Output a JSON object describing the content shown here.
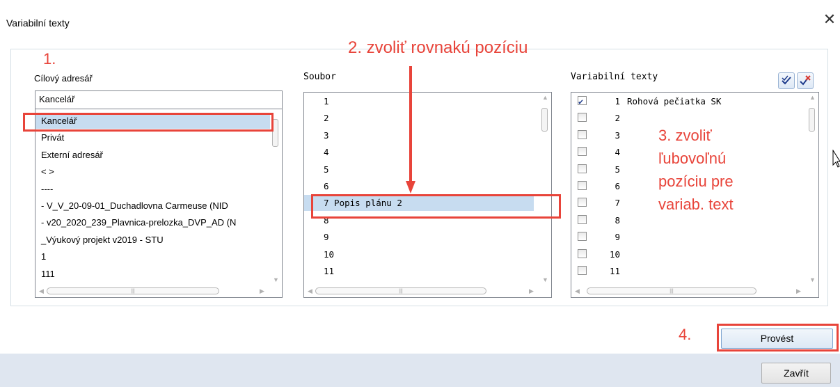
{
  "dialog": {
    "title": "Variabilní texty",
    "close_glyph": "✕"
  },
  "annotations": {
    "a1": "1.",
    "a2": "2. zvoliť rovnakú pozíciu",
    "a3_line1": "3. zvoliť",
    "a3_line2": "ľubovoľnú",
    "a3_line3": "pozíciu pre",
    "a3_line4": "variab. text",
    "a4": "4.",
    "color": "#e8443a"
  },
  "target_dir": {
    "label": "Cílový adresář",
    "combo_value": "Kancelář",
    "items": [
      "Kancelář",
      "Privát",
      "Externí adresář",
      "<       >",
      "----",
      "- V_V_20-09-01_Duchadlovna Carmeuse (NID",
      "- v20_2020_239_Plavnica-prelozka_DVP_AD (N",
      "_Výukový projekt v2019 - STU",
      "1",
      "111"
    ],
    "selected_index": 0
  },
  "file": {
    "label": "Soubor",
    "items": [
      "1",
      "2",
      "3",
      "4",
      "5",
      "6",
      "7 Popis plánu 2",
      "8",
      "9",
      "10",
      "11"
    ],
    "selected_index": 6
  },
  "variable_texts": {
    "label": "Variabilní texty",
    "check_all_icon": "check-all-icon",
    "uncheck_all_icon": "uncheck-all-icon",
    "items": [
      {
        "num": "1",
        "text": "Rohová pečiatka SK",
        "checked": true
      },
      {
        "num": "2",
        "text": "",
        "checked": false
      },
      {
        "num": "3",
        "text": "",
        "checked": false
      },
      {
        "num": "4",
        "text": "",
        "checked": false
      },
      {
        "num": "5",
        "text": "",
        "checked": false
      },
      {
        "num": "6",
        "text": "",
        "checked": false
      },
      {
        "num": "7",
        "text": "",
        "checked": false
      },
      {
        "num": "8",
        "text": "",
        "checked": false
      },
      {
        "num": "9",
        "text": "",
        "checked": false
      },
      {
        "num": "10",
        "text": "",
        "checked": false
      },
      {
        "num": "11",
        "text": "",
        "checked": false
      }
    ]
  },
  "buttons": {
    "execute": "Provést",
    "close": "Zavřít"
  },
  "colors": {
    "selection": "#c7dcf0",
    "footer": "#dfe6f0",
    "accent_red": "#e8443a"
  }
}
